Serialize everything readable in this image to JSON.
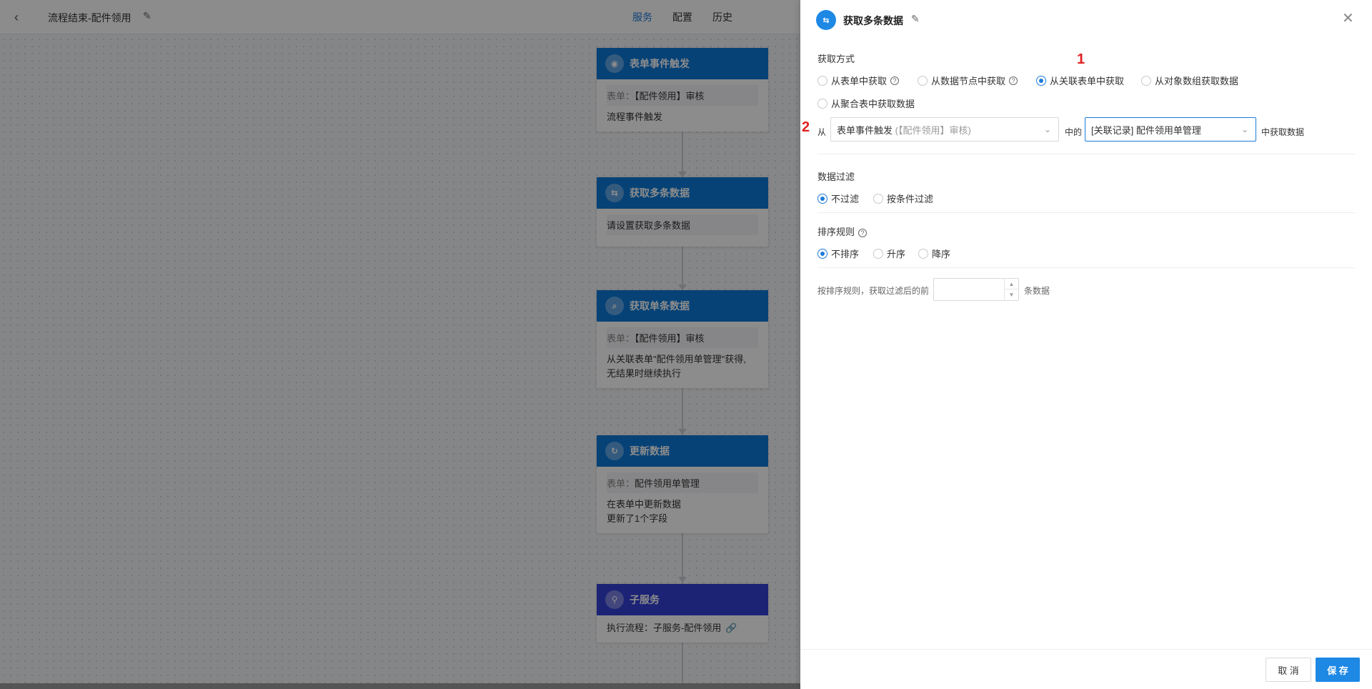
{
  "topbar": {
    "back": "‹",
    "title": "流程结束-配件领用",
    "edit_icon": "✎",
    "tabs": [
      "服务",
      "配置",
      "历史"
    ],
    "active_tab": 0
  },
  "nodes": [
    {
      "title": "表单事件触发",
      "icon": "◉",
      "field_label": "表单：",
      "field_value": "【配件领用】审核",
      "lines": [
        "流程事件触发"
      ]
    },
    {
      "title": "获取多条数据",
      "icon": "⇆",
      "field_label": "",
      "field_value": "请设置获取多条数据",
      "lines": []
    },
    {
      "title": "获取单条数据",
      "icon": "⌕",
      "field_label": "表单：",
      "field_value": "【配件领用】审核",
      "lines": [
        "从关联表单\"配件领用单管理\"获得,",
        "无结果时继续执行"
      ]
    },
    {
      "title": "更新数据",
      "icon": "↻",
      "field_label": "表单：",
      "field_value": "配件领用单管理",
      "lines": [
        "在表单中更新数据",
        "更新了1个字段"
      ]
    },
    {
      "title": "子服务",
      "icon": "⚲",
      "field_label": "",
      "field_value": "",
      "lines": [
        "执行流程：子服务-配件领用"
      ]
    }
  ],
  "drawer": {
    "icon": "⇆",
    "title": "获取多条数据",
    "edit_icon": "✎",
    "close_icon": "✕",
    "fetch_method": {
      "label": "获取方式",
      "options": [
        "从表单中获取",
        "从数据节点中获取",
        "从关联表单中获取",
        "从对象数组获取数据",
        "从聚合表中获取数据"
      ],
      "selected": "从关联表单中获取"
    },
    "annotations": {
      "mark1": "1",
      "mark2": "2"
    },
    "source": {
      "from_label": "从",
      "node_select": "表单事件触发",
      "node_select_hint": "(【配件领用】审核)",
      "in_label": "中的",
      "relation_select": "[关联记录] 配件领用单管理",
      "suffix": "中获取数据"
    },
    "filter": {
      "label": "数据过滤",
      "options": [
        "不过滤",
        "按条件过滤"
      ],
      "selected": "不过滤"
    },
    "sort": {
      "label": "排序规则",
      "options": [
        "不排序",
        "升序",
        "降序"
      ],
      "selected": "不排序"
    },
    "limit": {
      "prefix": "按排序规则，获取过滤后的前",
      "value": "",
      "suffix": "条数据"
    },
    "footer": {
      "cancel": "取 消",
      "save": "保 存"
    }
  }
}
